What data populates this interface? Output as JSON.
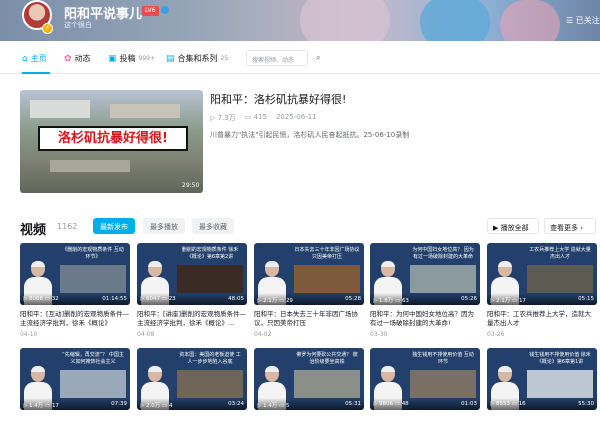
{
  "header": {
    "username": "阳和平说事儿",
    "level": "LV6",
    "signature": "这个很白",
    "follow_label": "已关注"
  },
  "nav": {
    "tabs": [
      {
        "label": "主页",
        "icon": "home-icon"
      },
      {
        "label": "动态",
        "icon": "dynamic-icon"
      },
      {
        "label": "投稿",
        "icon": "upload-icon",
        "count": "999+"
      },
      {
        "label": "合集和系列",
        "icon": "collection-icon",
        "count": "25"
      }
    ],
    "search_placeholder": "搜索视频、动态"
  },
  "featured": {
    "thumb_text": "洛杉矶抗暴好得很!",
    "duration": "29:50",
    "title": "阳和平：洛杉矶抗暴好得很!",
    "plays": "7.3万",
    "comments": "415",
    "date": "2025-06-11",
    "desc": "川普暴力\"执法\"引起民愤，洛杉矶人民奋起抵抗。25-06-10录制"
  },
  "videos_section": {
    "title": "视频",
    "count": "1162",
    "sort_tabs": [
      "最新发布",
      "最多播放",
      "最多收藏"
    ],
    "play_all": "播放全部",
    "view_more": "查看更多"
  },
  "videos": [
    {
      "cap": "《删削的宏观物质条件 互动环节》",
      "plays": "8066",
      "comments": "32",
      "duration": "01:14:55",
      "title": "阳和平：[互动]删削的宏观物质条件—主流经济学批判，徐禾《概论》",
      "date": "04-10"
    },
    {
      "cap": "删削的宏观物质条件 徐禾《概论》第6章第2讲",
      "plays": "6047",
      "comments": "23",
      "duration": "48:05",
      "title": "阳和平：[讲座]删削的宏观物质条件—主流经济学批判，徐禾《概论》...",
      "date": "04-08"
    },
    {
      "cap": "日本失去三十年非因广场协议 只因美帝打压",
      "plays": "2.1万",
      "comments": "29",
      "duration": "05:28",
      "title": "阳和平：日本失去三十年非因广场协议，只因美帝打压",
      "date": "04-02"
    },
    {
      "cap": "为何中国妇女地位高？ 因为有过一场破除封建的大革命",
      "plays": "1.8万",
      "comments": "63",
      "duration": "05:26",
      "title": "阳和平：为何中国妇女地位高？因为有过一场破除封建的大革命!",
      "date": "03-30"
    },
    {
      "cap": "工农兵推荐上大学 造就大量杰出人才",
      "plays": "2.1万",
      "comments": "17",
      "duration": "05:15",
      "title": "阳和平：工农兵推荐上大学，造就大量杰出人才",
      "date": "03-26"
    },
    {
      "cap": "“先缩辑，再交流”？ 中国主义如何掩饰社会主义",
      "plays": "1.4万",
      "comments": "17",
      "duration": "07:39",
      "title": "",
      "date": ""
    },
    {
      "cap": "资本国：美国的老板迫使 工人一步步地陷入谷底",
      "plays": "2.0万",
      "comments": "4",
      "duration": "03:24",
      "title": "",
      "date": ""
    },
    {
      "cap": "佛罗为何要砍公共交通？ 彼治阶级要坐高铁",
      "plays": "1.4万",
      "comments": "5",
      "duration": "05:31",
      "title": "",
      "date": ""
    },
    {
      "cap": "独生钱用不排使用价值 互动环节",
      "plays": "9806",
      "comments": "48",
      "duration": "01:03",
      "title": "",
      "date": ""
    },
    {
      "cap": "钱生钱用不排使用价值 徐禾《概论》第6章第1讲",
      "plays": "8553",
      "comments": "16",
      "duration": "55:30",
      "title": "",
      "date": ""
    }
  ],
  "colors": {
    "accent": "#00aeec",
    "thumb_blue": "#23406c",
    "alert_red": "#d7141a"
  }
}
